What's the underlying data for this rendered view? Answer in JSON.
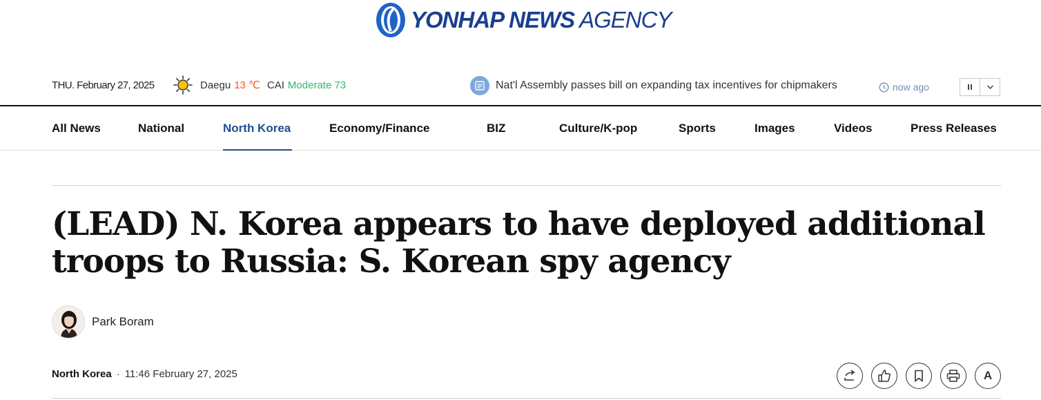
{
  "header": {
    "logo_text_bold": "YONHAP NEWS",
    "logo_text_light": "AGENCY"
  },
  "topbar": {
    "date": "THU. February 27, 2025",
    "weather": {
      "icon": "sun-icon",
      "city": "Daegu",
      "temperature": "13 ℃",
      "cai_label": "CAI",
      "cai_value": "Moderate 73"
    },
    "ticker": {
      "icon": "news-icon",
      "headline": "Nat'l Assembly passes bill on expanding tax incentives for chipmakers",
      "time_ago": "now ago"
    },
    "controls": {
      "pause_icon": "pause-icon",
      "more_icon": "chevron-down-icon"
    }
  },
  "nav": {
    "items": [
      {
        "label": "All News"
      },
      {
        "label": "National"
      },
      {
        "label": "North Korea",
        "active": true
      },
      {
        "label": "Economy/Finance"
      },
      {
        "label": "BIZ"
      },
      {
        "label": "Culture/K-pop"
      },
      {
        "label": "Sports"
      },
      {
        "label": "Images"
      },
      {
        "label": "Videos"
      },
      {
        "label": "Press Releases"
      }
    ]
  },
  "article": {
    "title": "(LEAD) N. Korea appears to have deployed additional troops to Russia: S. Korean spy agency",
    "author": "Park Boram",
    "section": "North Korea",
    "separator": "·",
    "timestamp": "11:46 February 27, 2025",
    "tools": [
      {
        "icon": "share-icon"
      },
      {
        "icon": "thumbs-up-icon"
      },
      {
        "icon": "bookmark-icon"
      },
      {
        "icon": "print-icon"
      },
      {
        "icon": "font-size-icon",
        "label": "A"
      }
    ]
  },
  "colors": {
    "brand": "#1a3f8f",
    "active_nav": "#1d4f8f",
    "temperature": "#f05a2a",
    "cai_good": "#3ab36d",
    "ticker_icon": "#7ea7dc"
  }
}
